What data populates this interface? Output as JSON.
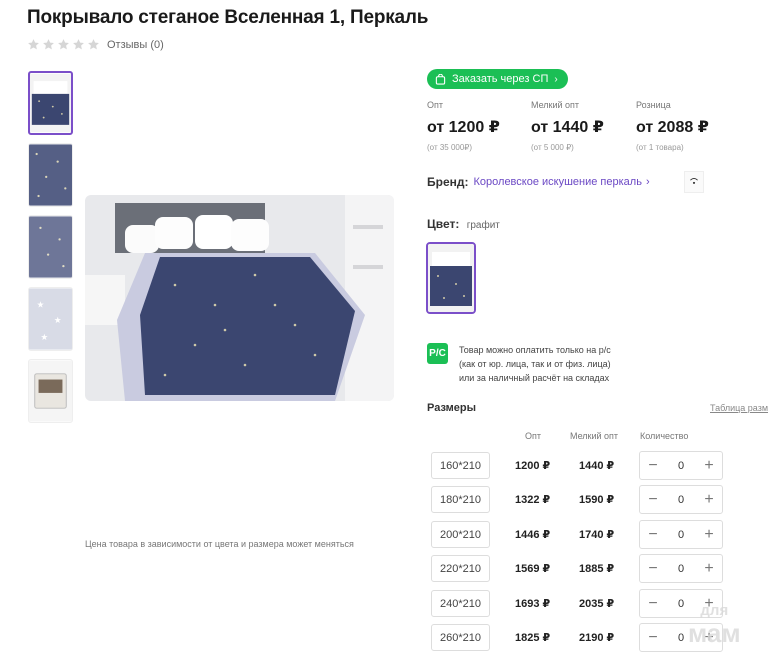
{
  "product": {
    "title": "Покрывало стеганое Вселенная 1, Перкаль",
    "reviews": "Отзывы (0)",
    "stars_filled": 0,
    "stars_total": 5,
    "price_note": "Цена товара в зависимости от цвета и размера может меняться"
  },
  "order_button": {
    "label": "Заказать через СП",
    "color": "#1bbf55"
  },
  "prices": [
    {
      "label": "Опт",
      "value": "от 1200 ₽",
      "min": "(от 35 000₽)"
    },
    {
      "label": "Мелкий опт",
      "value": "от 1440 ₽",
      "min": "(от 5 000 ₽)"
    },
    {
      "label": "Розница",
      "value": "от 2088 ₽",
      "min": "(от 1 товара)"
    }
  ],
  "brand": {
    "label": "Бренд:",
    "value": "Королевское искушение перкаль"
  },
  "color": {
    "label": "Цвет:",
    "value": "графит"
  },
  "payment_note": {
    "badge": "Р/С",
    "lines": [
      "Товар можно оплатить только на р/с",
      "(как от юр. лица, так и от физ. лица)",
      "или за наличный расчёт на складах"
    ]
  },
  "sizes": {
    "title": "Размеры",
    "table_link": "Таблица разм",
    "headers": {
      "wholesale": "Опт",
      "small_wholesale": "Мелкий опт",
      "quantity": "Количество"
    },
    "rows": [
      {
        "size": "160*210",
        "opt": "1200 ₽",
        "small_opt": "1440 ₽",
        "qty": "0"
      },
      {
        "size": "180*210",
        "opt": "1322 ₽",
        "small_opt": "1590 ₽",
        "qty": "0"
      },
      {
        "size": "200*210",
        "opt": "1446 ₽",
        "small_opt": "1740 ₽",
        "qty": "0"
      },
      {
        "size": "220*210",
        "opt": "1569 ₽",
        "small_opt": "1885 ₽",
        "qty": "0"
      },
      {
        "size": "240*210",
        "opt": "1693 ₽",
        "small_opt": "2035 ₽",
        "qty": "0"
      },
      {
        "size": "260*210",
        "opt": "1825 ₽",
        "small_opt": "2190 ₽",
        "qty": "0"
      }
    ]
  },
  "watermark": {
    "line1": "для",
    "line2": "мам"
  },
  "colors": {
    "accent": "#7b4fc9",
    "brand_link": "#6b48c4",
    "green": "#1bbf55",
    "navy": "#3b4670"
  }
}
